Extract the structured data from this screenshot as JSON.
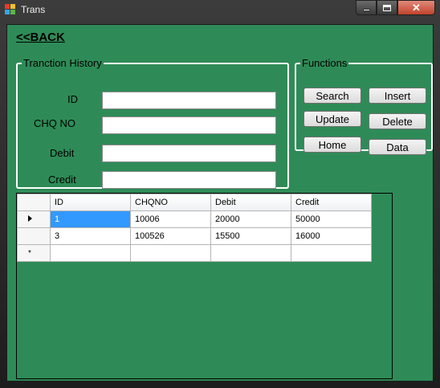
{
  "window": {
    "title": "Trans",
    "controls": {
      "minimize_icon": "minimize-icon",
      "maximize_icon": "maximize-icon",
      "close_icon": "close-icon",
      "close_glyph": "✕"
    }
  },
  "back_link": "<<BACK",
  "history": {
    "legend": "Tranction History",
    "fields": [
      {
        "label": "ID",
        "value": ""
      },
      {
        "label": "CHQ NO",
        "value": ""
      },
      {
        "label": "Debit",
        "value": ""
      },
      {
        "label": "Credit",
        "value": ""
      }
    ]
  },
  "functions": {
    "legend": "Functions",
    "buttons": {
      "search": "Search",
      "insert": "Insert",
      "update": "Update",
      "delete": "Delete",
      "home": "Home",
      "data": "Data"
    }
  },
  "grid": {
    "columns": [
      "ID",
      "CHQNO",
      "Debit",
      "Credit"
    ],
    "rows": [
      [
        "1",
        "10006",
        "20000",
        "50000"
      ],
      [
        "3",
        "100526",
        "15500",
        "16000"
      ]
    ],
    "new_row_marker": "*"
  },
  "colors": {
    "form_background": "#2e8b57",
    "selection": "#3399ff"
  }
}
